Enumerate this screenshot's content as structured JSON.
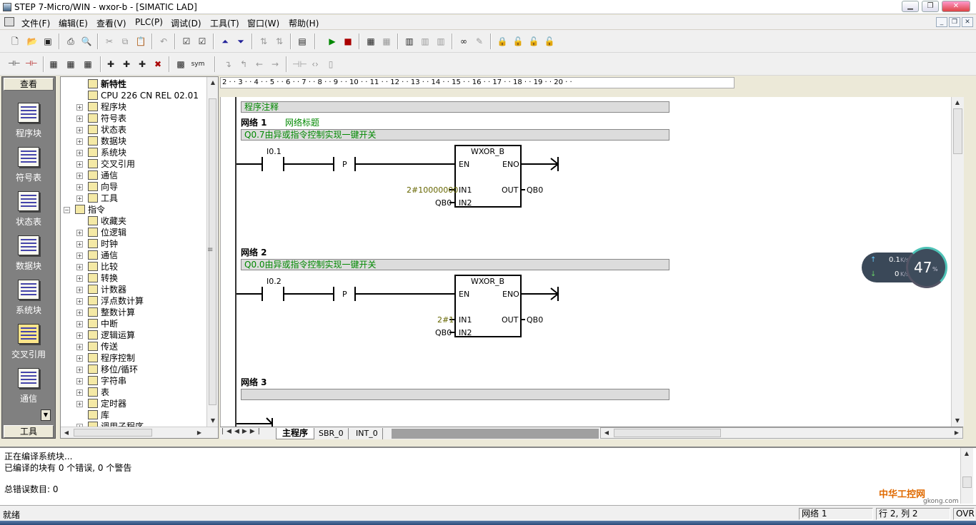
{
  "window": {
    "title": "STEP 7-Micro/WIN - wxor-b - [SIMATIC LAD]"
  },
  "menu": [
    "文件(F)",
    "编辑(E)",
    "查看(V)",
    "PLC(P)",
    "调试(D)",
    "工具(T)",
    "窗口(W)",
    "帮助(H)"
  ],
  "toolbar2": {
    "sym_label": "sym"
  },
  "navbar": {
    "header": "查看",
    "items": [
      "程序块",
      "符号表",
      "状态表",
      "数据块",
      "系统块",
      "交叉引用",
      "通信"
    ],
    "bottom": "工具"
  },
  "tree": {
    "nodes": [
      {
        "label": "新特性",
        "bold": true,
        "level": 1
      },
      {
        "label": "CPU 226 CN REL 02.01",
        "level": 1
      },
      {
        "label": "程序块",
        "level": 1,
        "plus": true
      },
      {
        "label": "符号表",
        "level": 1,
        "plus": true
      },
      {
        "label": "状态表",
        "level": 1,
        "plus": true
      },
      {
        "label": "数据块",
        "level": 1,
        "plus": true
      },
      {
        "label": "系统块",
        "level": 1,
        "plus": true
      },
      {
        "label": "交叉引用",
        "level": 1,
        "plus": true
      },
      {
        "label": "通信",
        "level": 1,
        "plus": true
      },
      {
        "label": "向导",
        "level": 1,
        "plus": true
      },
      {
        "label": "工具",
        "level": 1,
        "plus": true
      },
      {
        "label": "指令",
        "level": 0,
        "minus": true
      },
      {
        "label": "收藏夹",
        "level": 1
      },
      {
        "label": "位逻辑",
        "level": 1,
        "plus": true
      },
      {
        "label": "时钟",
        "level": 1,
        "plus": true
      },
      {
        "label": "通信",
        "level": 1,
        "plus": true
      },
      {
        "label": "比较",
        "level": 1,
        "plus": true
      },
      {
        "label": "转换",
        "level": 1,
        "plus": true
      },
      {
        "label": "计数器",
        "level": 1,
        "plus": true
      },
      {
        "label": "浮点数计算",
        "level": 1,
        "plus": true
      },
      {
        "label": "整数计算",
        "level": 1,
        "plus": true
      },
      {
        "label": "中断",
        "level": 1,
        "plus": true
      },
      {
        "label": "逻辑运算",
        "level": 1,
        "plus": true
      },
      {
        "label": "传送",
        "level": 1,
        "plus": true
      },
      {
        "label": "程序控制",
        "level": 1,
        "plus": true
      },
      {
        "label": "移位/循环",
        "level": 1,
        "plus": true
      },
      {
        "label": "字符串",
        "level": 1,
        "plus": true
      },
      {
        "label": "表",
        "level": 1,
        "plus": true
      },
      {
        "label": "定时器",
        "level": 1,
        "plus": true
      },
      {
        "label": "库",
        "level": 1
      },
      {
        "label": "调用子程序",
        "level": 1,
        "plus": true
      }
    ]
  },
  "ruler": {
    "text": "2 · · 3 · · 4 · · 5 · · 6 · · 7 · · 8 · · 9 · · 10 · · 11 · · 12 · · 13 · · 14 · · 15 · · 16 · · 17 · · 18 · · 19 · · 20 · ·"
  },
  "editor": {
    "program_comment": "程序注释",
    "networks": [
      {
        "label": "网络 1",
        "title": "网络标题",
        "comment": "Q0.7由异或指令控制实现一键开关",
        "contact": "I0.1",
        "edge": "P",
        "box": "WXOR_B",
        "en": "EN",
        "eno": "ENO",
        "in1_pin": "IN1",
        "in2_pin": "IN2",
        "out_pin": "OUT",
        "in1": "2#10000000",
        "in2": "QB0",
        "out": "QB0"
      },
      {
        "label": "网络 2",
        "title": "",
        "comment": "Q0.0由异或指令控制实现一键开关",
        "contact": "I0.2",
        "edge": "P",
        "box": "WXOR_B",
        "en": "EN",
        "eno": "ENO",
        "in1_pin": "IN1",
        "in2_pin": "IN2",
        "out_pin": "OUT",
        "in1": "2#1",
        "in2": "QB0",
        "out": "QB0"
      },
      {
        "label": "网络 3",
        "title": "",
        "comment": ""
      }
    ]
  },
  "tabs": [
    "主程序",
    "SBR_0",
    "INT_0"
  ],
  "output": {
    "lines": [
      "正在编译系统块...",
      "已编译的块有 0 个错误, 0 个警告",
      "",
      "总错误数目: 0"
    ]
  },
  "status": {
    "ready": "就绪",
    "network": "网络 1",
    "position": "行 2, 列 2",
    "mode": "OVR"
  },
  "netmon": {
    "up": "0.1",
    "down": "0",
    "unit": "K/s",
    "percent": "47",
    "percent_sign": "%"
  },
  "watermark": {
    "text": "中华工控网",
    "url": "gkong.com"
  }
}
